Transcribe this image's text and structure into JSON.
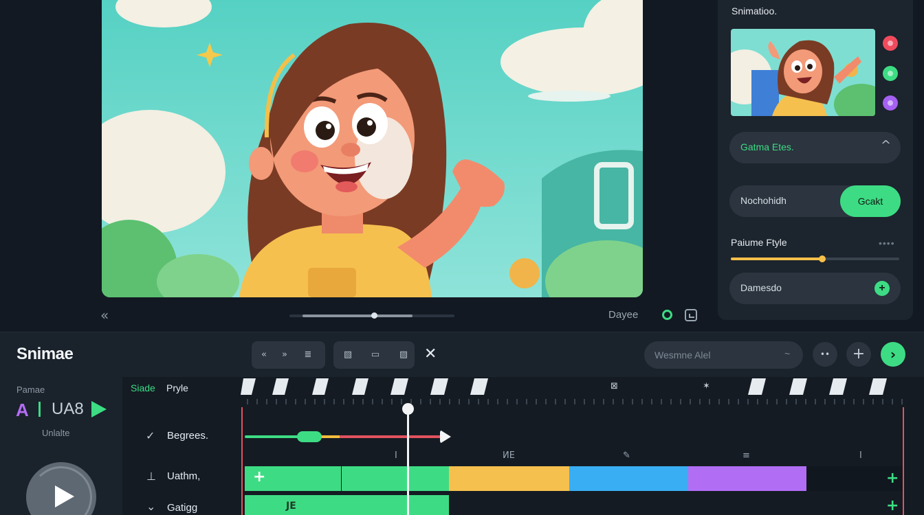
{
  "preview": {
    "back_glyph": "«",
    "label": "Dayee"
  },
  "panel": {
    "title": "Snimatioo.",
    "dropdown_label": "Gatma Etes.",
    "dropdown_chevron": "^",
    "row_label": "Nochohidh",
    "row_button": "Gcakt",
    "style_label": "Paiume Ftyle",
    "style_menu": "••••",
    "slider_value": 0.54,
    "bottom_label": "Damesdo",
    "swatches": [
      "#ef4b5d",
      "#3ddc84",
      "#a561f2"
    ]
  },
  "toolbar": {
    "title": "Snimae",
    "group1": [
      "«",
      "»",
      "≣"
    ],
    "group2": [
      "▧",
      "▭",
      "▨"
    ],
    "close": "✕",
    "search_placeholder": "Wesmne Alel",
    "search_icon": "~",
    "btn1": "••",
    "btn2": "+",
    "btn3": "›"
  },
  "left": {
    "label": "Pamae",
    "a": "A",
    "num": "UA8",
    "sub": "Unlalte"
  },
  "timeline": {
    "style_green": "Siade",
    "style_white": "Pryle",
    "ruler_icons": [
      "⊠",
      "✶"
    ],
    "tracks": [
      {
        "icon": "✓",
        "label": "Begrees."
      },
      {
        "icon": "⊥",
        "label": "Uathm,"
      },
      {
        "icon": "⌄",
        "label": "Gatigg"
      }
    ],
    "markers": [
      "I",
      "ИЕ",
      "✎",
      "≡",
      "I"
    ],
    "clip_label": "JE",
    "accent": "#3ddc84"
  }
}
